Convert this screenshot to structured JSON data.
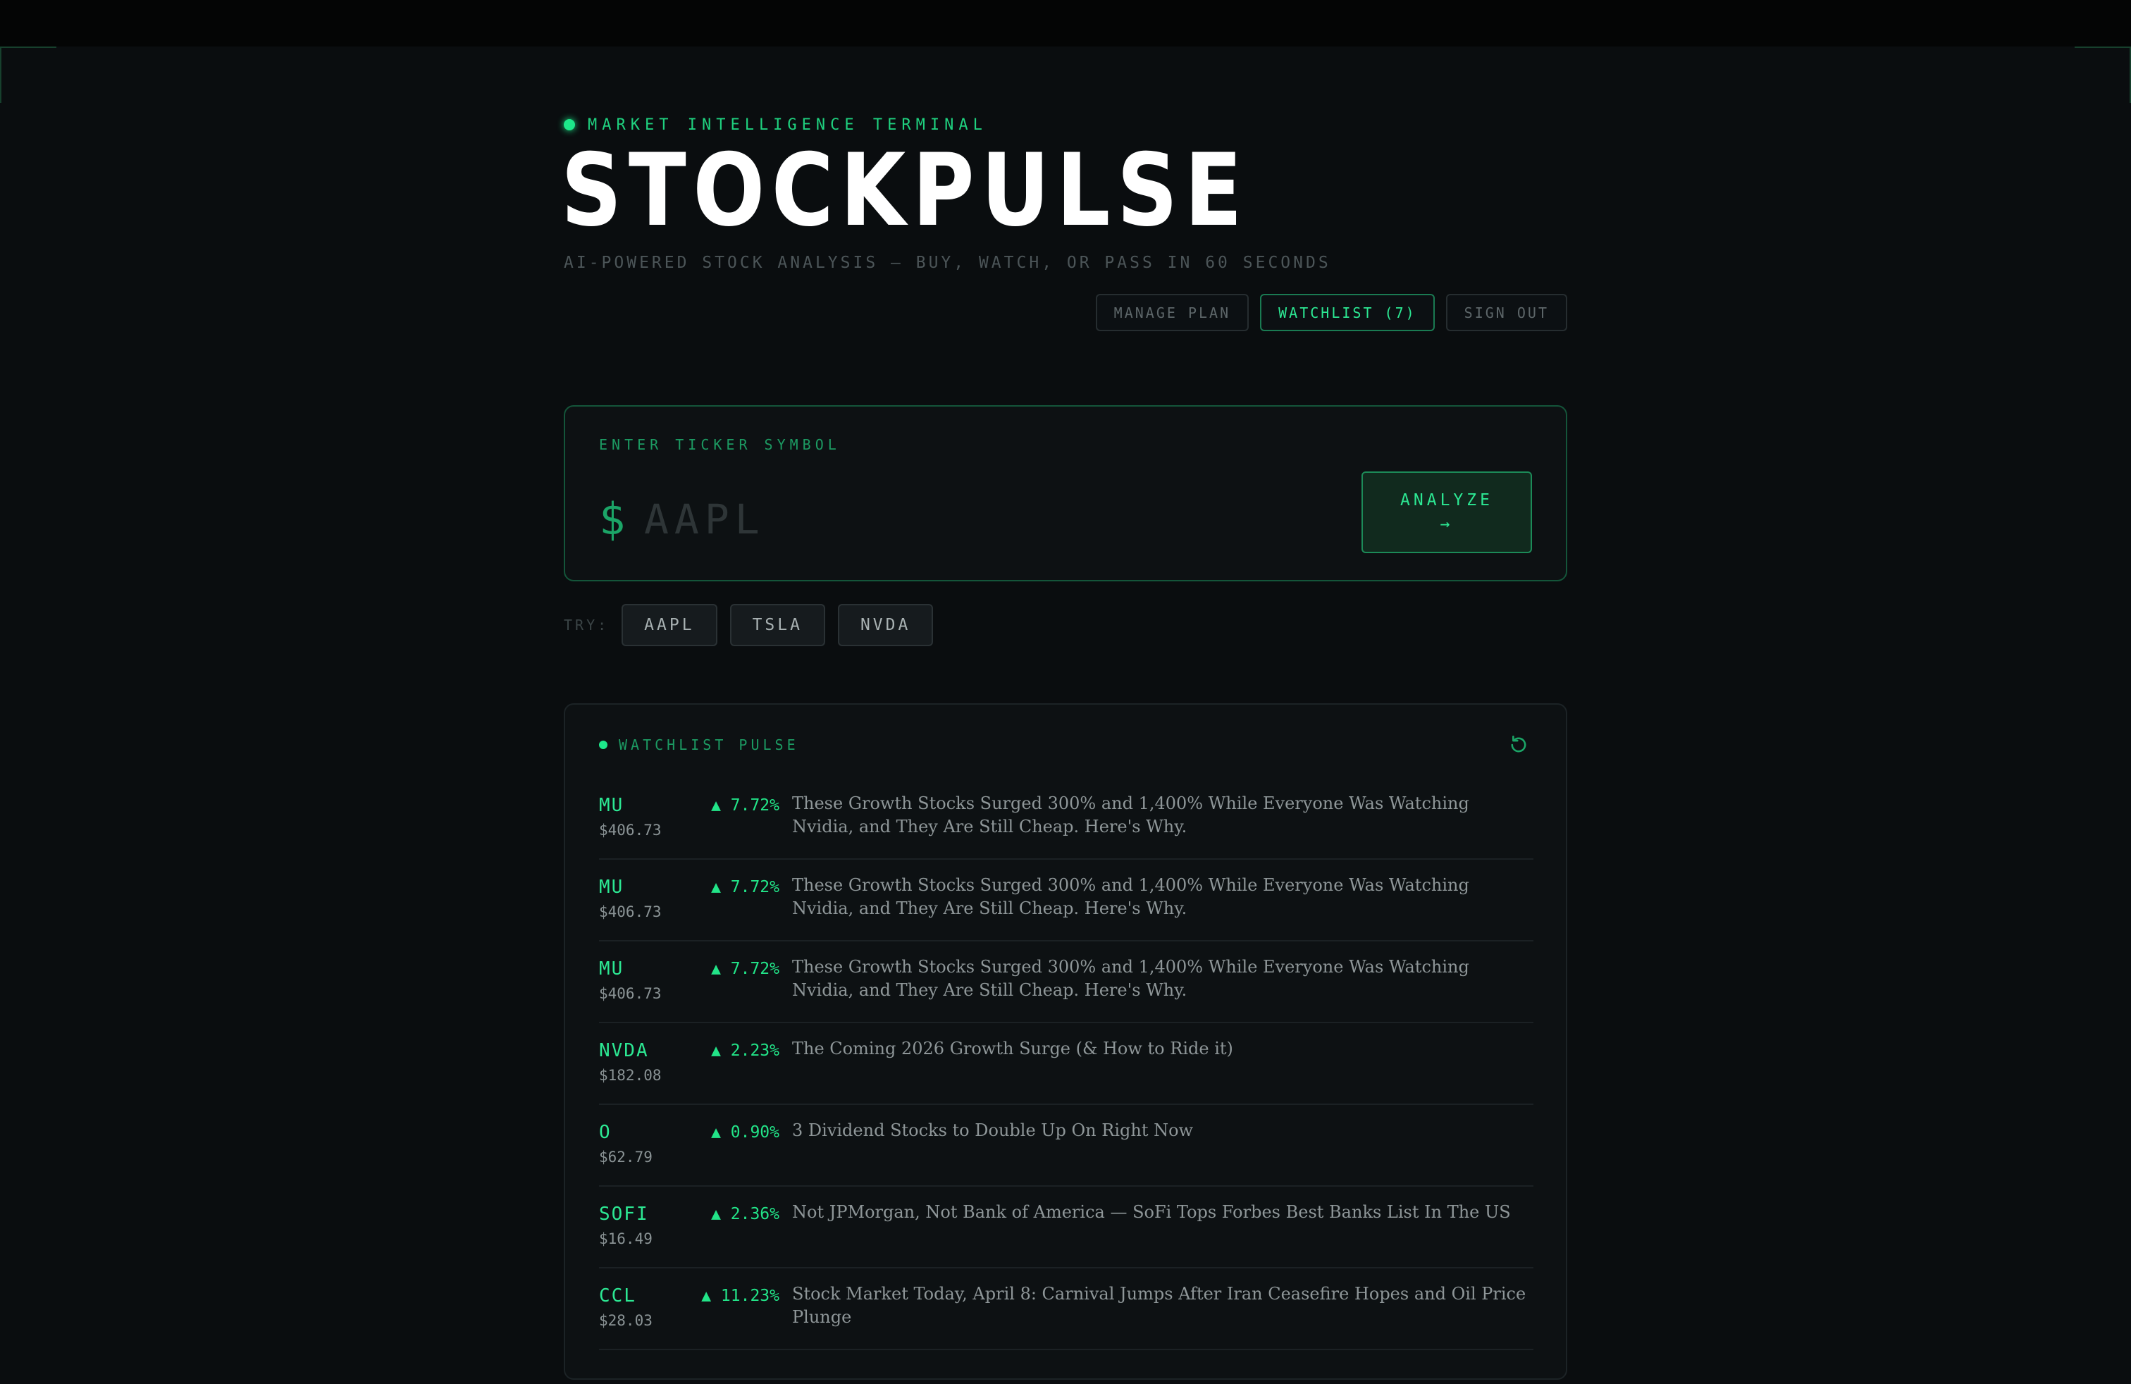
{
  "app": {
    "eyebrow": "MARKET INTELLIGENCE TERMINAL",
    "title": "STOCKPULSE",
    "subtitle": "AI-POWERED STOCK ANALYSIS — BUY, WATCH, OR PASS IN 60 SECONDS"
  },
  "nav": {
    "manage_plan": "MANAGE PLAN",
    "watchlist": "WATCHLIST (7)",
    "sign_out": "SIGN OUT"
  },
  "search": {
    "label": "ENTER TICKER SYMBOL",
    "prefix": "$",
    "placeholder": "AAPL",
    "analyze_label": "ANALYZE",
    "analyze_arrow": "→"
  },
  "try": {
    "label": "TRY:",
    "chips": [
      "AAPL",
      "TSLA",
      "NVDA"
    ]
  },
  "pulse": {
    "title": "WATCHLIST PULSE",
    "rows": [
      {
        "symbol": "MU",
        "price": "$406.73",
        "change": "▲ 7.72%",
        "headline": "These Growth Stocks Surged 300% and 1,400% While Everyone Was Watching Nvidia, and They Are Still Cheap. Here's Why."
      },
      {
        "symbol": "MU",
        "price": "$406.73",
        "change": "▲ 7.72%",
        "headline": "These Growth Stocks Surged 300% and 1,400% While Everyone Was Watching Nvidia, and They Are Still Cheap. Here's Why."
      },
      {
        "symbol": "MU",
        "price": "$406.73",
        "change": "▲ 7.72%",
        "headline": "These Growth Stocks Surged 300% and 1,400% While Everyone Was Watching Nvidia, and They Are Still Cheap. Here's Why."
      },
      {
        "symbol": "NVDA",
        "price": "$182.08",
        "change": "▲ 2.23%",
        "headline": "The Coming 2026 Growth Surge (& How to Ride it)"
      },
      {
        "symbol": "O",
        "price": "$62.79",
        "change": "▲ 0.90%",
        "headline": "3 Dividend Stocks to Double Up On Right Now"
      },
      {
        "symbol": "SOFI",
        "price": "$16.49",
        "change": "▲ 2.36%",
        "headline": "Not JPMorgan, Not Bank of America — SoFi Tops Forbes Best Banks List In The US"
      },
      {
        "symbol": "CCL",
        "price": "$28.03",
        "change": "▲ 11.23%",
        "headline": "Stock Market Today, April 8: Carnival Jumps After Iran Ceasefire Hopes and Oil Price Plunge"
      }
    ]
  },
  "colors": {
    "accent": "#2ce893",
    "background": "#0a0d0f",
    "card_border": "#14553a"
  },
  "icons": {
    "refresh": "refresh-icon"
  }
}
